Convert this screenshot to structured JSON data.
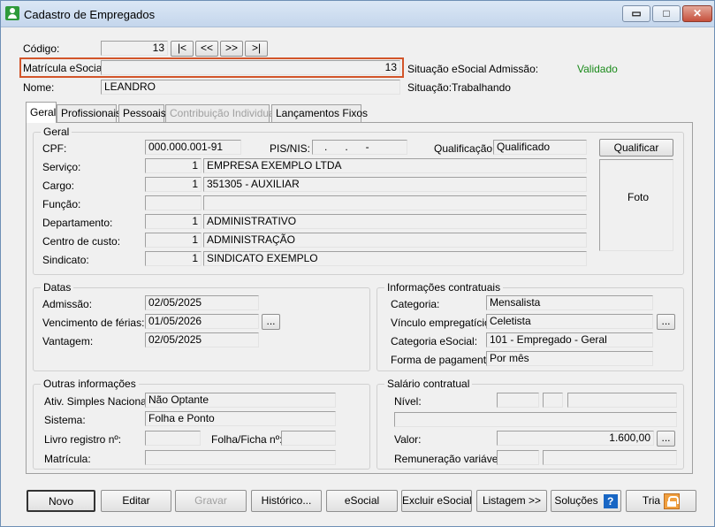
{
  "window": {
    "title": "Cadastro de Empregados",
    "minimize": "▭",
    "maximize": "□",
    "close": "✕"
  },
  "header": {
    "codigo_label": "Código:",
    "codigo_value": "13",
    "nav": [
      "|<",
      "<<",
      ">>",
      ">|"
    ],
    "matricula_label": "Matrícula eSocial:",
    "matricula_value": "13",
    "nome_label": "Nome:",
    "nome_value": "LEANDRO",
    "situacao_esocial_label": "Situação eSocial Admissão:",
    "situacao_esocial_value": "Validado",
    "situacao_label": "Situação:",
    "situacao_value": "Trabalhando",
    "colors": {
      "validado": "#1a8a1a",
      "highlight": "#d2552a"
    }
  },
  "tabs": [
    "Geral",
    "Profissionais",
    "Pessoais",
    "Contribuição Individual",
    "Lançamentos Fixos"
  ],
  "geral": {
    "title": "Geral",
    "cpf_label": "CPF:",
    "cpf_value": "000.000.001-91",
    "pis_label": "PIS/NIS:",
    "pis_value": "   .      .      -",
    "qualificacao_label": "Qualificação:",
    "qualificacao_value": "Qualificado",
    "qualificar_button": "Qualificar",
    "foto_label": "Foto",
    "rows": [
      {
        "label": "Serviço:",
        "code": "1",
        "desc": "EMPRESA EXEMPLO LTDA"
      },
      {
        "label": "Cargo:",
        "code": "1",
        "desc": "351305 - AUXILIAR"
      },
      {
        "label": "Função:",
        "code": "",
        "desc": ""
      },
      {
        "label": "Departamento:",
        "code": "1",
        "desc": "ADMINISTRATIVO"
      },
      {
        "label": "Centro de custo:",
        "code": "1",
        "desc": "ADMINISTRAÇÃO"
      },
      {
        "label": "Sindicato:",
        "code": "1",
        "desc": "SINDICATO EXEMPLO"
      }
    ]
  },
  "datas": {
    "title": "Datas",
    "admissao_label": "Admissão:",
    "admissao_value": "02/05/2025",
    "ferias_label": "Vencimento de férias:",
    "ferias_value": "01/05/2026",
    "vantagem_label": "Vantagem:",
    "vantagem_value": "02/05/2025",
    "ellipsis": "..."
  },
  "contratuais": {
    "title": "Informações contratuais",
    "categoria_label": "Categoria:",
    "categoria_value": "Mensalista",
    "vinculo_label": "Vínculo empregatício:",
    "vinculo_value": "Celetista",
    "cat_esocial_label": "Categoria eSocial:",
    "cat_esocial_value": "101 - Empregado - Geral",
    "forma_label": "Forma de pagamento:",
    "forma_value": "Por mês",
    "ellipsis": "..."
  },
  "outras": {
    "title": "Outras informações",
    "simples_label": "Ativ. Simples Nacional:",
    "simples_value": "Não Optante",
    "sistema_label": "Sistema:",
    "sistema_value": "Folha e Ponto",
    "livro_label": "Livro registro nº:",
    "livro_value": "",
    "folha_label": "Folha/Ficha nº:",
    "folha_value": "",
    "matricula_label": "Matrícula:",
    "matricula_value": ""
  },
  "salario": {
    "title": "Salário contratual",
    "nivel_label": "Nível:",
    "valor_label": "Valor:",
    "valor_value": "1.600,00",
    "remuneracao_label": "Remuneração variável:",
    "ellipsis": "..."
  },
  "footer": {
    "novo": "Novo",
    "editar": "Editar",
    "gravar": "Gravar",
    "historico": "Histórico...",
    "esocial": "eSocial",
    "excluir": "Excluir eSocial",
    "listagem": "Listagem >>",
    "solucoes": "Soluções",
    "help": "?",
    "tria": "Tria"
  }
}
